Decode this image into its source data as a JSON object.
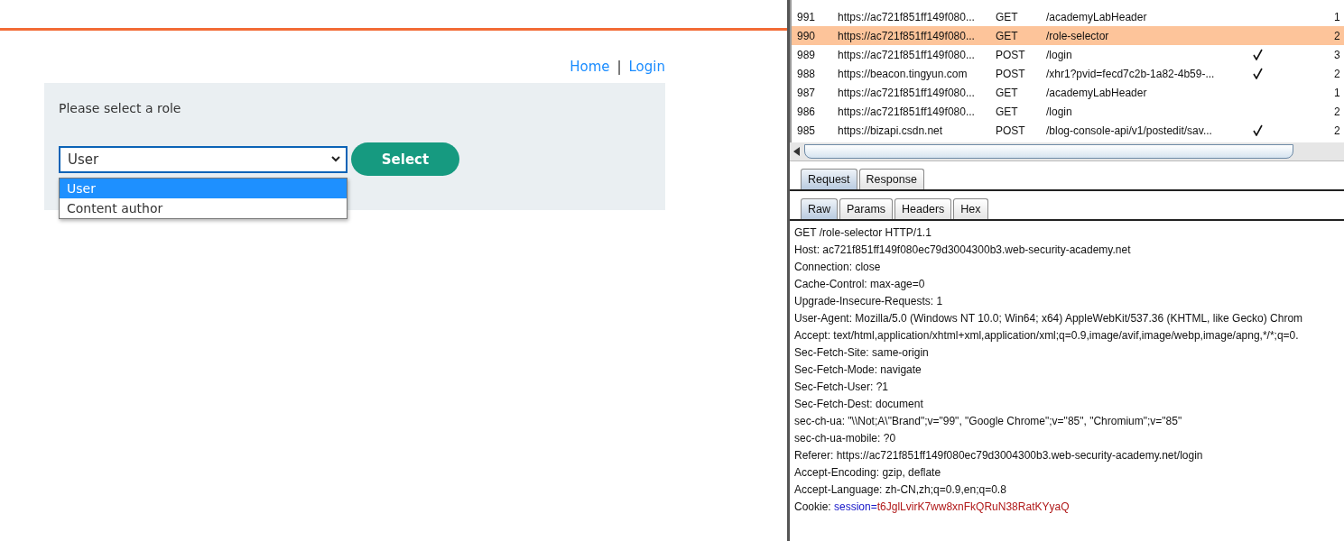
{
  "page": {
    "nav": [
      {
        "label": "Home"
      },
      {
        "label": "Login"
      }
    ],
    "nav_separator": "|",
    "prompt": "Please select a role",
    "role_select": {
      "value": "User",
      "expanded": true,
      "options": [
        {
          "label": "User",
          "selected": true
        },
        {
          "label": "Content author",
          "selected": false
        }
      ]
    },
    "submit_button": "Select"
  },
  "proxy": {
    "history": {
      "rows": [
        {
          "number": "991",
          "host": "https://ac721f851ff149f080...",
          "method": "GET",
          "url": "/academyLabHeader",
          "edited": false,
          "status": "1",
          "selected": false
        },
        {
          "number": "990",
          "host": "https://ac721f851ff149f080...",
          "method": "GET",
          "url": "/role-selector",
          "edited": false,
          "status": "2",
          "selected": true
        },
        {
          "number": "989",
          "host": "https://ac721f851ff149f080...",
          "method": "POST",
          "url": "/login",
          "edited": true,
          "status": "3",
          "selected": false
        },
        {
          "number": "988",
          "host": "https://beacon.tingyun.com",
          "method": "POST",
          "url": "/xhr1?pvid=fecd7c2b-1a82-4b59-...",
          "edited": true,
          "status": "2",
          "selected": false
        },
        {
          "number": "987",
          "host": "https://ac721f851ff149f080...",
          "method": "GET",
          "url": "/academyLabHeader",
          "edited": false,
          "status": "1",
          "selected": false
        },
        {
          "number": "986",
          "host": "https://ac721f851ff149f080...",
          "method": "GET",
          "url": "/login",
          "edited": false,
          "status": "2",
          "selected": false
        },
        {
          "number": "985",
          "host": "https://bizapi.csdn.net",
          "method": "POST",
          "url": "/blog-console-api/v1/postedit/sav...",
          "edited": true,
          "status": "2",
          "selected": false
        }
      ]
    },
    "tabs": [
      {
        "label": "Request",
        "selected": true
      },
      {
        "label": "Response",
        "selected": false
      }
    ],
    "subtabs": [
      {
        "label": "Raw",
        "selected": true
      },
      {
        "label": "Params",
        "selected": false
      },
      {
        "label": "Headers",
        "selected": false
      },
      {
        "label": "Hex",
        "selected": false
      }
    ],
    "raw_lines": [
      "GET /role-selector HTTP/1.1",
      "Host: ac721f851ff149f080ec79d3004300b3.web-security-academy.net",
      "Connection: close",
      "Cache-Control: max-age=0",
      "Upgrade-Insecure-Requests: 1",
      "User-Agent: Mozilla/5.0 (Windows NT 10.0; Win64; x64) AppleWebKit/537.36 (KHTML, like Gecko) Chrom",
      "Accept: text/html,application/xhtml+xml,application/xml;q=0.9,image/avif,image/webp,image/apng,*/*;q=0.",
      "Sec-Fetch-Site: same-origin",
      "Sec-Fetch-Mode: navigate",
      "Sec-Fetch-User: ?1",
      "Sec-Fetch-Dest: document",
      "sec-ch-ua: \"\\\\Not;A\\\"Brand\";v=\"99\", \"Google Chrome\";v=\"85\", \"Chromium\";v=\"85\"",
      "sec-ch-ua-mobile: ?0",
      "Referer: https://ac721f851ff149f080ec79d3004300b3.web-security-academy.net/login",
      "Accept-Encoding: gzip, deflate",
      "Accept-Language: zh-CN,zh;q=0.9,en;q=0.8"
    ],
    "cookie": {
      "label": "Cookie: ",
      "name": "session",
      "equals": "=",
      "value": "t6JglLvirK7ww8xnFkQRuN38RatKYyaQ"
    }
  }
}
